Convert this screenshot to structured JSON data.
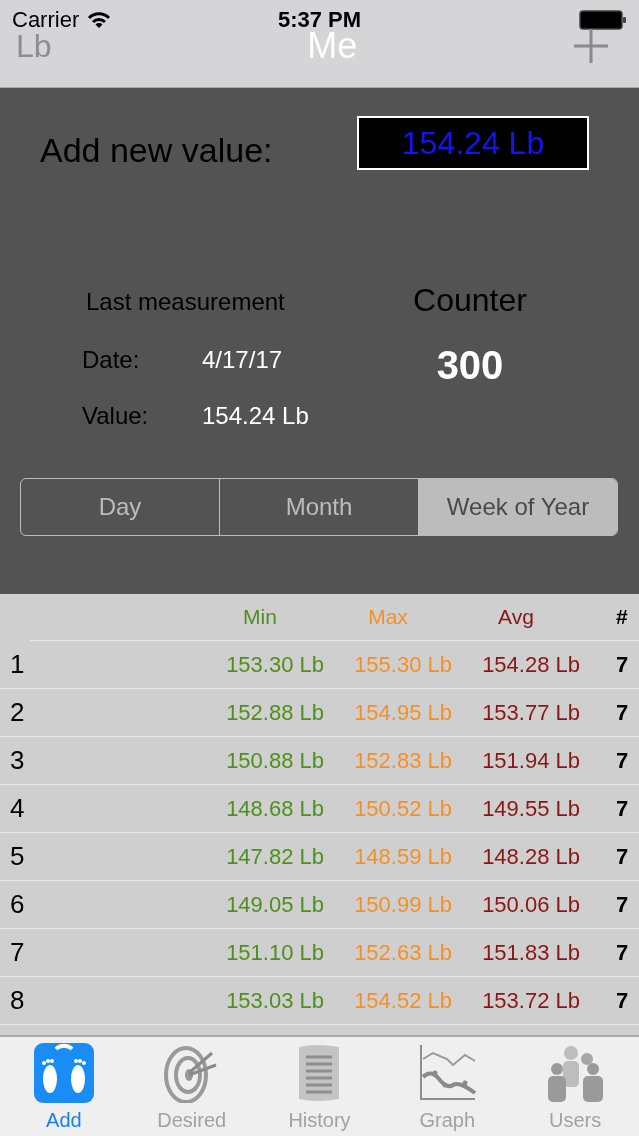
{
  "status_bar": {
    "carrier": "Carrier",
    "time": "5:37 PM"
  },
  "nav_bar": {
    "left": "Lb",
    "title": "Me"
  },
  "entry": {
    "label": "Add new value:",
    "value": "154.24 Lb"
  },
  "last_measurement": {
    "title": "Last measurement",
    "date_label": "Date:",
    "date": "4/17/17",
    "value_label": "Value:",
    "value": "154.24 Lb"
  },
  "counter": {
    "label": "Counter",
    "value": "300"
  },
  "segments": [
    {
      "label": "Day",
      "selected": false
    },
    {
      "label": "Month",
      "selected": false
    },
    {
      "label": "Week of Year",
      "selected": true
    }
  ],
  "table": {
    "columns": [
      {
        "label": "Min",
        "color": "#4f8f1c"
      },
      {
        "label": "Max",
        "color": "#f39127"
      },
      {
        "label": "Avg",
        "color": "#8a1616"
      },
      {
        "label": "#",
        "color": "#000000"
      }
    ],
    "rows": [
      {
        "index": "1",
        "cells": [
          "153.30 Lb",
          "155.30 Lb",
          "154.28 Lb",
          "7"
        ]
      },
      {
        "index": "2",
        "cells": [
          "152.88 Lb",
          "154.95 Lb",
          "153.77 Lb",
          "7"
        ]
      },
      {
        "index": "3",
        "cells": [
          "150.88 Lb",
          "152.83 Lb",
          "151.94 Lb",
          "7"
        ]
      },
      {
        "index": "4",
        "cells": [
          "148.68 Lb",
          "150.52 Lb",
          "149.55 Lb",
          "7"
        ]
      },
      {
        "index": "5",
        "cells": [
          "147.82 Lb",
          "148.59 Lb",
          "148.28 Lb",
          "7"
        ]
      },
      {
        "index": "6",
        "cells": [
          "149.05 Lb",
          "150.99 Lb",
          "150.06 Lb",
          "7"
        ]
      },
      {
        "index": "7",
        "cells": [
          "151.10 Lb",
          "152.63 Lb",
          "151.83 Lb",
          "7"
        ]
      },
      {
        "index": "8",
        "cells": [
          "153.03 Lb",
          "154.52 Lb",
          "153.72 Lb",
          "7"
        ]
      }
    ]
  },
  "tab_bar": [
    {
      "label": "Add",
      "kind": "scale",
      "selected": true
    },
    {
      "label": "Desired",
      "kind": "target",
      "selected": false
    },
    {
      "label": "History",
      "kind": "document",
      "selected": false
    },
    {
      "label": "Graph",
      "kind": "graph",
      "selected": false
    },
    {
      "label": "Users",
      "kind": "users",
      "selected": false
    }
  ]
}
